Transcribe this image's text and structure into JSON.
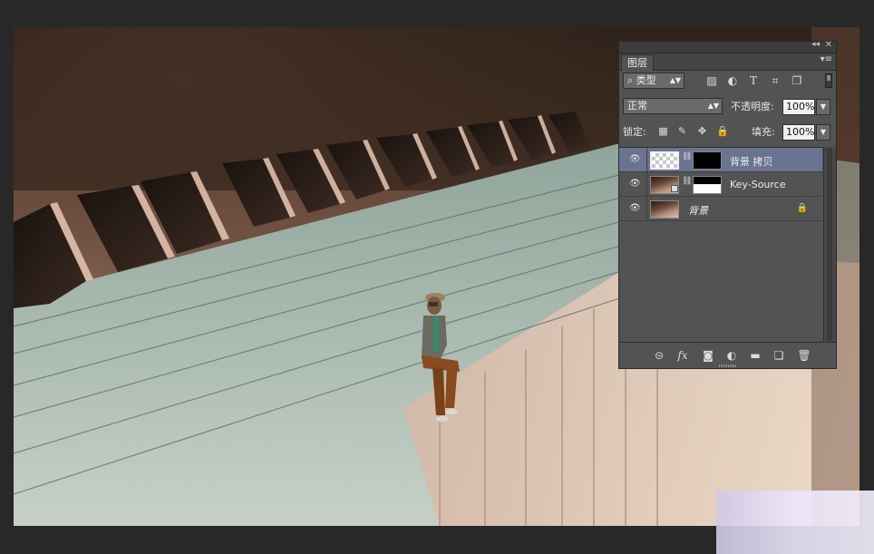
{
  "panel": {
    "tab_label": "图层",
    "collapse_glyph": "◂◂",
    "close_glyph": "✕",
    "menu_glyph": "▾≡",
    "filter": {
      "kind_label": "类型",
      "search_glyph": "⌕"
    },
    "filter_icons": [
      "image-filter-icon",
      "adjustment-filter-icon",
      "type-filter-icon",
      "shape-filter-icon",
      "smart-object-filter-icon"
    ],
    "blend_mode": "正常",
    "opacity_label": "不透明度:",
    "opacity_value": "100%",
    "lock_label": "锁定:",
    "fill_label": "填充:",
    "fill_value": "100%",
    "layers": [
      {
        "name": "背景 拷贝",
        "visible": true,
        "selected": true
      },
      {
        "name": "Key-Source",
        "visible": true,
        "selected": false
      },
      {
        "name": "背景",
        "visible": true,
        "selected": false,
        "locked": true
      }
    ],
    "footer_icons": [
      "link-layers-icon",
      "layer-style-fx-icon",
      "add-mask-icon",
      "new-adjustment-icon",
      "new-group-icon",
      "new-layer-icon",
      "delete-layer-icon"
    ]
  },
  "colors": {
    "app_background": "#282828",
    "panel_background": "#535353",
    "selected_layer": "#6a7390"
  }
}
